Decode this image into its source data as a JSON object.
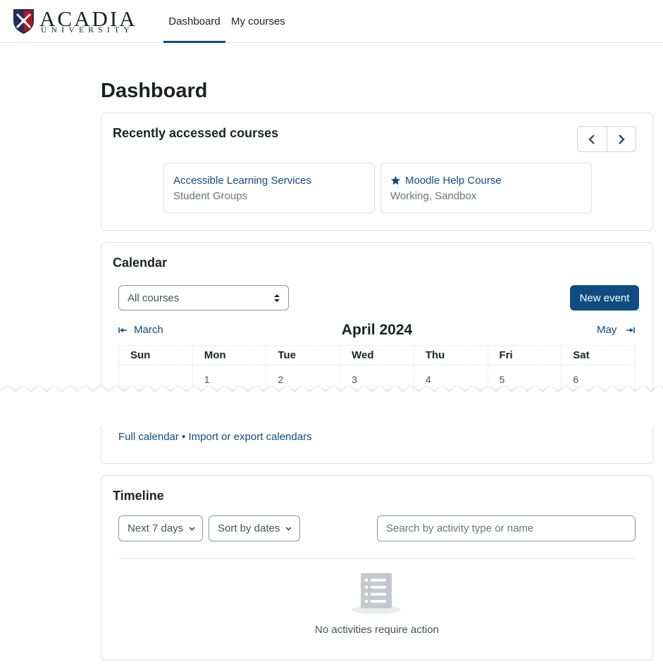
{
  "header": {
    "logo_main": "ACADIA",
    "logo_sub": "UNIVERSITY",
    "nav": [
      {
        "label": "Dashboard",
        "active": true
      },
      {
        "label": "My courses",
        "active": false
      }
    ]
  },
  "page": {
    "title": "Dashboard"
  },
  "recent": {
    "title": "Recently accessed courses",
    "courses": [
      {
        "name": "Accessible Learning Services",
        "category": "Student Groups",
        "starred": false
      },
      {
        "name": "Moodle Help Course",
        "category": "Working, Sandbox",
        "starred": true
      }
    ]
  },
  "calendar": {
    "title": "Calendar",
    "course_filter": "All courses",
    "new_event_label": "New event",
    "prev_month": "March",
    "next_month": "May",
    "month_title": "April 2024",
    "weekdays": [
      "Sun",
      "Mon",
      "Tue",
      "Wed",
      "Thu",
      "Fri",
      "Sat"
    ],
    "first_week": [
      "",
      "1",
      "2",
      "3",
      "4",
      "5",
      "6"
    ],
    "link_full": "Full calendar",
    "link_separator": " • ",
    "link_import": "Import or export calendars"
  },
  "timeline": {
    "title": "Timeline",
    "days_filter": "Next 7 days",
    "sort_filter": "Sort by dates",
    "search_placeholder": "Search by activity type or name",
    "empty_text": "No activities require action"
  },
  "colors": {
    "brand_blue": "#0f4c81",
    "text": "#1d2125",
    "muted": "#6a737b",
    "border": "#dee2e6"
  }
}
